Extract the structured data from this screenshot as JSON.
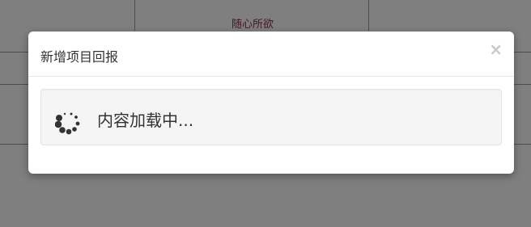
{
  "background": {
    "cell_text": "随心所欲",
    "cell_text_color": "#8b2c4b"
  },
  "modal": {
    "title": "新增项目回报",
    "close_label": "×",
    "loading_text": "内容加载中..."
  },
  "icons": {
    "spinner": "loading-spinner-icon",
    "close": "close-icon"
  }
}
